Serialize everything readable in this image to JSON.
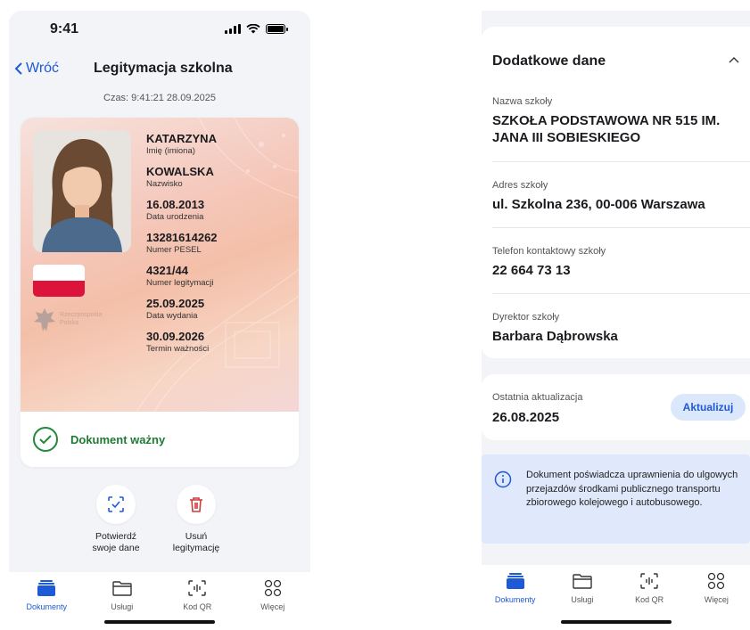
{
  "status": {
    "time": "9:41"
  },
  "header": {
    "back_label": "Wróć",
    "title": "Legitymacja szkolna"
  },
  "timestamp": "Czas: 9:41:21 28.09.2025",
  "card": {
    "emblem_text": [
      "Rzeczpospolita",
      "Polska"
    ],
    "fields": [
      {
        "value": "KATARZYNA",
        "label": "Imię (imiona)"
      },
      {
        "value": "KOWALSKA",
        "label": "Nazwisko"
      },
      {
        "value": "16.08.2013",
        "label": "Data urodzenia"
      },
      {
        "value": "13281614262",
        "label": "Numer PESEL"
      },
      {
        "value": "4321/44",
        "label": "Numer legitymacji"
      },
      {
        "value": "25.09.2025",
        "label": "Data wydania"
      },
      {
        "value": "30.09.2026",
        "label": "Termin ważności"
      }
    ],
    "status_text": "Dokument ważny",
    "status_color": "#1f8a3b"
  },
  "actions": [
    {
      "line1": "Potwierdź",
      "line2": "swoje dane",
      "icon": "scan-check-icon"
    },
    {
      "line1": "Usuń",
      "line2": "legitymację",
      "icon": "trash-icon"
    }
  ],
  "tabs": [
    {
      "label": "Dokumenty",
      "icon": "wallet-icon",
      "active": true
    },
    {
      "label": "Usługi",
      "icon": "folder-icon",
      "active": false
    },
    {
      "label": "Kod QR",
      "icon": "qr-scan-icon",
      "active": false
    },
    {
      "label": "Więcej",
      "icon": "grid-icon",
      "active": false
    }
  ],
  "details": {
    "title": "Dodatkowe dane",
    "rows": [
      {
        "label": "Nazwa szkoły",
        "value": "SZKOŁA PODSTAWOWA NR 515 IM. JANA III SOBIESKIEGO"
      },
      {
        "label": "Adres szkoły",
        "value": "ul. Szkolna 236, 00-006 Warszawa"
      },
      {
        "label": "Telefon kontaktowy szkoły",
        "value": "22 664 73 13"
      },
      {
        "label": "Dyrektor szkoły",
        "value": "Barbara Dąbrowska"
      }
    ]
  },
  "update": {
    "label": "Ostatnia aktualizacja",
    "value": "26.08.2025",
    "button": "Aktualizuj"
  },
  "notice": "Dokument poświadcza uprawnienia do ulgowych przejazdów środkami publicznego transportu zbiorowego kolejowego i autobusowego.",
  "colors": {
    "accent": "#1e59d6",
    "valid": "#1f8a3b",
    "danger": "#d13b3b",
    "notice_bg": "#dfe9fb"
  }
}
